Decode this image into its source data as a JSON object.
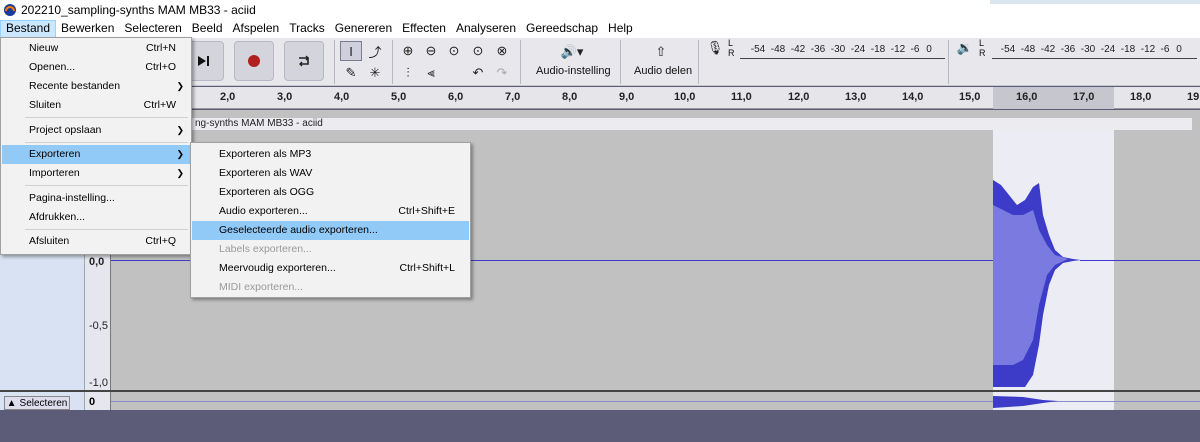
{
  "window": {
    "title": "202210_sampling-synths MAM MB33 - aciid"
  },
  "menubar": [
    "Bestand",
    "Bewerken",
    "Selecteren",
    "Beeld",
    "Afspelen",
    "Tracks",
    "Genereren",
    "Effecten",
    "Analyseren",
    "Gereedschap",
    "Help"
  ],
  "toolbar": {
    "audio_setup_label": "Audio-instelling",
    "audio_share_label": "Audio delen",
    "record_meter_ticks": [
      "-54",
      "-48",
      "-42",
      "-36",
      "-30",
      "-24",
      "-18",
      "-12",
      "-6",
      "0"
    ],
    "play_meter_ticks": [
      "-54",
      "-48",
      "-42",
      "-36",
      "-30",
      "-24",
      "-18",
      "-12",
      "-6",
      "0"
    ],
    "meter_lr": [
      "L",
      "R"
    ]
  },
  "ruler": {
    "ticks": [
      "2,0",
      "3,0",
      "4,0",
      "5,0",
      "6,0",
      "7,0",
      "8,0",
      "9,0",
      "10,0",
      "11,0",
      "12,0",
      "13,0",
      "14,0",
      "15,0",
      "16,0",
      "17,0",
      "18,0",
      "19"
    ]
  },
  "track": {
    "name": "ng-synths MAM MB33 - aciid",
    "scale": [
      "0,0",
      "-0,5",
      "-1,0"
    ],
    "second_scale_zero": "0",
    "select_button": "Selecteren"
  },
  "file_menu": {
    "items": [
      {
        "label": "Nieuw",
        "shortcut": "Ctrl+N",
        "submenu": false
      },
      {
        "label": "Openen...",
        "shortcut": "Ctrl+O",
        "submenu": false
      },
      {
        "label": "Recente bestanden",
        "shortcut": "",
        "submenu": true
      },
      {
        "label": "Sluiten",
        "shortcut": "Ctrl+W",
        "submenu": false
      },
      {
        "label": "Project opslaan",
        "shortcut": "",
        "submenu": true
      },
      {
        "label": "Exporteren",
        "shortcut": "",
        "submenu": true
      },
      {
        "label": "Importeren",
        "shortcut": "",
        "submenu": true
      },
      {
        "label": "Pagina-instelling...",
        "shortcut": "",
        "submenu": false
      },
      {
        "label": "Afdrukken...",
        "shortcut": "",
        "submenu": false
      },
      {
        "label": "Afsluiten",
        "shortcut": "Ctrl+Q",
        "submenu": false
      }
    ]
  },
  "export_menu": {
    "items": [
      {
        "label": "Exporteren als MP3",
        "shortcut": "",
        "enabled": true
      },
      {
        "label": "Exporteren als WAV",
        "shortcut": "",
        "enabled": true
      },
      {
        "label": "Exporteren als OGG",
        "shortcut": "",
        "enabled": true
      },
      {
        "label": "Audio exporteren...",
        "shortcut": "Ctrl+Shift+E",
        "enabled": true
      },
      {
        "label": "Geselecteerde audio exporteren...",
        "shortcut": "",
        "enabled": true
      },
      {
        "label": "Labels exporteren...",
        "shortcut": "",
        "enabled": false
      },
      {
        "label": "Meervoudig exporteren...",
        "shortcut": "Ctrl+Shift+L",
        "enabled": true
      },
      {
        "label": "MIDI exporteren...",
        "shortcut": "",
        "enabled": false
      }
    ]
  },
  "colors": {
    "waveform": "#3c3cc8",
    "selection": "#ececf5",
    "menu_highlight": "#91c9f7"
  }
}
